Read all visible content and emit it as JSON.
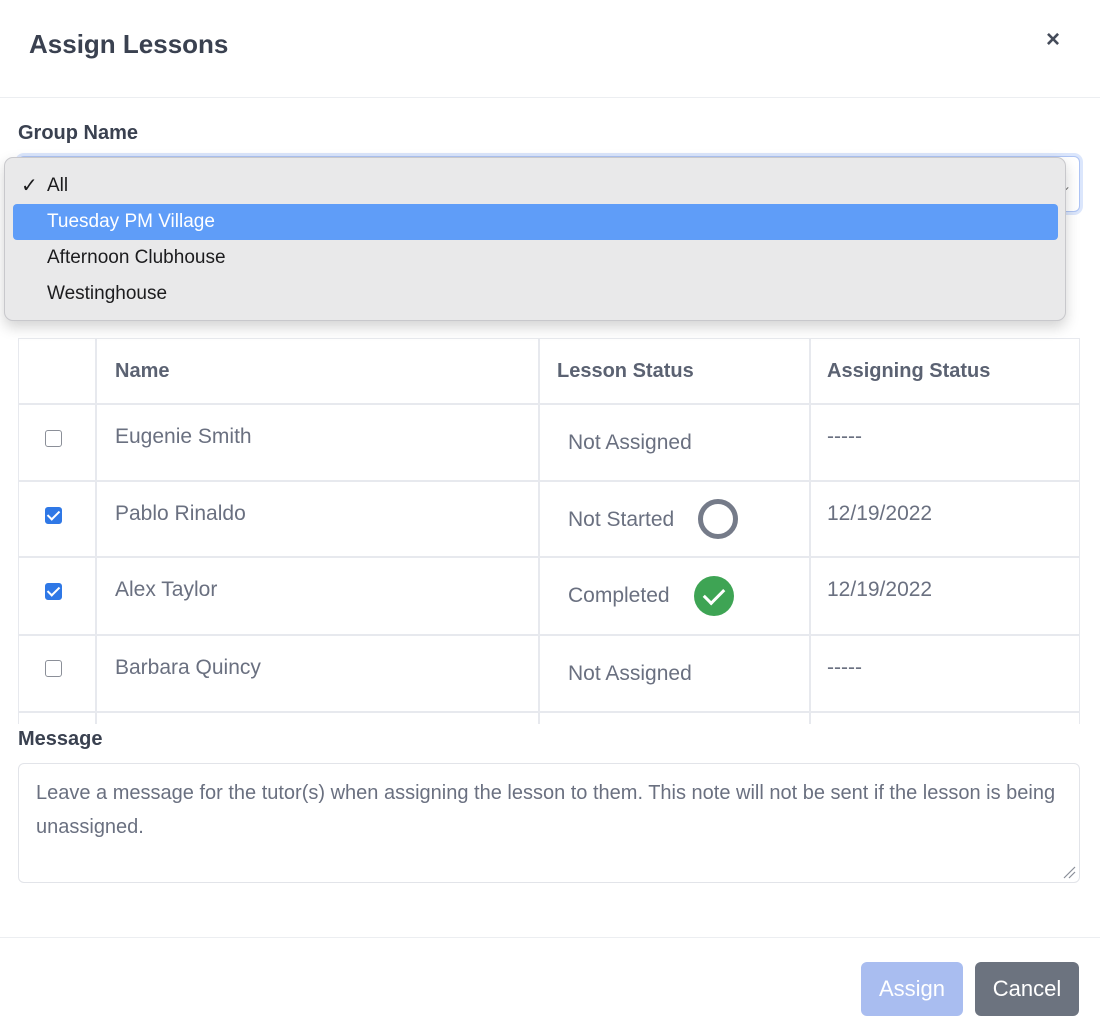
{
  "modal": {
    "title": "Assign Lessons",
    "close_label": "×"
  },
  "group": {
    "label": "Group Name",
    "selected": "All",
    "options": [
      {
        "label": "All",
        "checked": true,
        "highlighted": false
      },
      {
        "label": "Tuesday PM Village",
        "checked": false,
        "highlighted": true
      },
      {
        "label": "Afternoon Clubhouse",
        "checked": false,
        "highlighted": false
      },
      {
        "label": "Westinghouse",
        "checked": false,
        "highlighted": false
      }
    ],
    "check_glyph": "✓"
  },
  "table": {
    "headers": [
      "",
      "Name",
      "Lesson Status",
      "Assigning Status"
    ],
    "rows": [
      {
        "checked": false,
        "name": "Eugenie Smith",
        "lesson_status": "Not Assigned",
        "status_icon": "none",
        "assigning_status": "-----"
      },
      {
        "checked": true,
        "name": "Pablo Rinaldo",
        "lesson_status": "Not Started",
        "status_icon": "empty-circle-icon",
        "assigning_status": "12/19/2022"
      },
      {
        "checked": true,
        "name": "Alex Taylor",
        "lesson_status": "Completed",
        "status_icon": "green-check-circle-icon",
        "assigning_status": "12/19/2022"
      },
      {
        "checked": false,
        "name": "Barbara Quincy",
        "lesson_status": "Not Assigned",
        "status_icon": "none",
        "assigning_status": "-----"
      }
    ]
  },
  "message": {
    "label": "Message",
    "placeholder": "Leave a message for the tutor(s) when assigning the lesson to them. This note will not be sent if the lesson is being unassigned."
  },
  "footer": {
    "assign_label": "Assign",
    "cancel_label": "Cancel"
  },
  "colors": {
    "highlight": "#5f9df8",
    "checkbox_on": "#2f78e6",
    "completed": "#3ea454",
    "assign_button": "#a9bdf0",
    "cancel_button": "#6c737f"
  }
}
